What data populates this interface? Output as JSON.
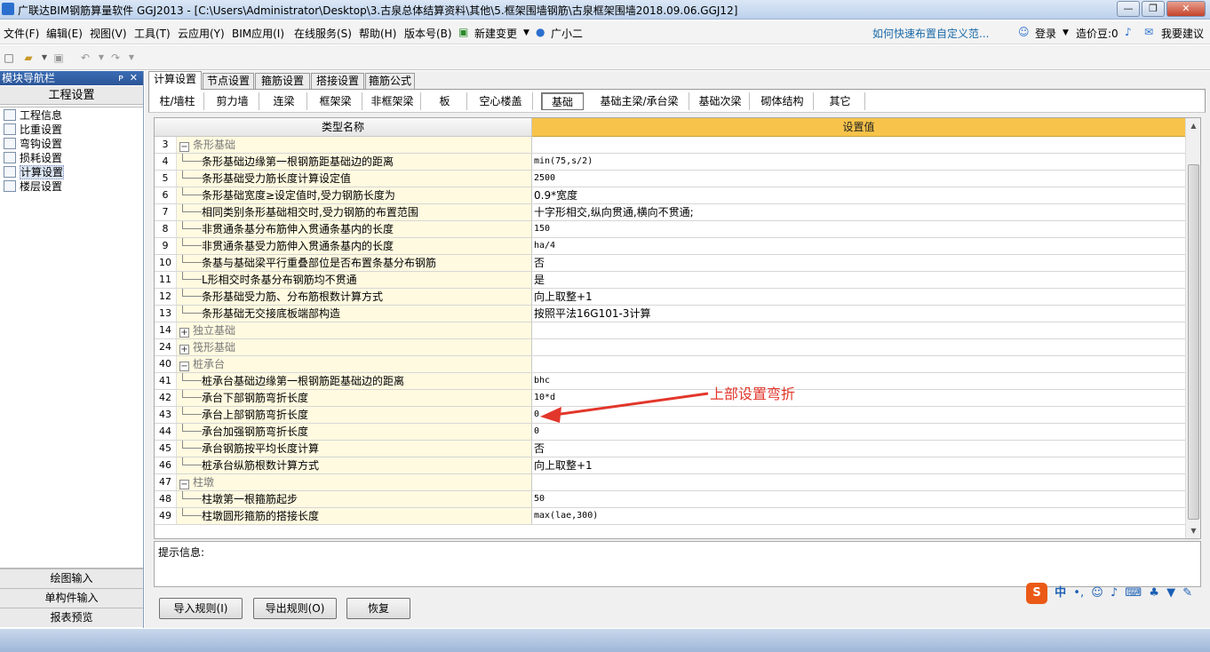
{
  "window": {
    "title": "广联达BIM钢筋算量软件 GGJ2013 - [C:\\Users\\Administrator\\Desktop\\3.古泉总体结算资料\\其他\\5.框架围墙钢筋\\古泉框架围墙2018.09.06.GGJ12]",
    "min": "—",
    "max": "❐",
    "close": "✕"
  },
  "menu": {
    "items": [
      "文件(F)",
      "编辑(E)",
      "视图(V)",
      "工具(T)",
      "云应用(Y)",
      "BIM应用(I)",
      "在线服务(S)",
      "帮助(H)",
      "版本号(B)",
      "新建变更",
      "广小二"
    ],
    "link": "如何快速布置自定义范...",
    "login": "登录",
    "price_bean": "造价豆:0",
    "suggest": "我要建议"
  },
  "nav": {
    "header": "模块导航栏",
    "pin": "ᴘ",
    "close": "✕",
    "section": "工程设置",
    "tree": [
      "工程信息",
      "比重设置",
      "弯钩设置",
      "损耗设置",
      "计算设置",
      "楼层设置"
    ],
    "bottom": [
      "绘图输入",
      "单构件输入",
      "报表预览"
    ]
  },
  "tabs1": [
    "计算设置",
    "节点设置",
    "箍筋设置",
    "搭接设置",
    "箍筋公式"
  ],
  "tabs2": [
    "柱/墙柱",
    "剪力墙",
    "连梁",
    "框架梁",
    "非框架梁",
    "板",
    "空心楼盖",
    "基础",
    "基础主梁/承台梁",
    "基础次梁",
    "砌体结构",
    "其它"
  ],
  "grid": {
    "col_name": "类型名称",
    "col_value": "设置值",
    "rows": [
      {
        "num": "3",
        "name": "条形基础",
        "value": "",
        "group": true,
        "exp": "−"
      },
      {
        "num": "4",
        "name": "条形基础边缘第一根钢筋距基础边的距离",
        "value": "min(75,s/2)"
      },
      {
        "num": "5",
        "name": "条形基础受力筋长度计算设定值",
        "value": "2500"
      },
      {
        "num": "6",
        "name": "条形基础宽度≥设定值时,受力钢筋长度为",
        "value": "0.9*宽度"
      },
      {
        "num": "7",
        "name": "相同类别条形基础相交时,受力钢筋的布置范围",
        "value": "十字形相交,纵向贯通,横向不贯通;"
      },
      {
        "num": "8",
        "name": "非贯通条基分布筋伸入贯通条基内的长度",
        "value": "150"
      },
      {
        "num": "9",
        "name": "非贯通条基受力筋伸入贯通条基内的长度",
        "value": "ha/4"
      },
      {
        "num": "10",
        "name": "条基与基础梁平行重叠部位是否布置条基分布钢筋",
        "value": "否"
      },
      {
        "num": "11",
        "name": "L形相交时条基分布钢筋均不贯通",
        "value": "是"
      },
      {
        "num": "12",
        "name": "条形基础受力筋、分布筋根数计算方式",
        "value": "向上取整+1"
      },
      {
        "num": "13",
        "name": "条形基础无交接底板端部构造",
        "value": "按照平法16G101-3计算"
      },
      {
        "num": "14",
        "name": "独立基础",
        "value": "",
        "group": true,
        "exp": "+"
      },
      {
        "num": "24",
        "name": "筏形基础",
        "value": "",
        "group": true,
        "exp": "+"
      },
      {
        "num": "40",
        "name": "桩承台",
        "value": "",
        "group": true,
        "exp": "−"
      },
      {
        "num": "41",
        "name": "桩承台基础边缘第一根钢筋距基础边的距离",
        "value": "bhc"
      },
      {
        "num": "42",
        "name": "承台下部钢筋弯折长度",
        "value": "10*d"
      },
      {
        "num": "43",
        "name": "承台上部钢筋弯折长度",
        "value": "0"
      },
      {
        "num": "44",
        "name": "承台加强钢筋弯折长度",
        "value": "0"
      },
      {
        "num": "45",
        "name": "承台钢筋按平均长度计算",
        "value": "否"
      },
      {
        "num": "46",
        "name": "桩承台纵筋根数计算方式",
        "value": "向上取整+1"
      },
      {
        "num": "47",
        "name": "柱墩",
        "value": "",
        "group": true,
        "exp": "−"
      },
      {
        "num": "48",
        "name": "柱墩第一根箍筋起步",
        "value": "50"
      },
      {
        "num": "49",
        "name": "柱墩圆形箍筋的搭接长度",
        "value": "max(lae,300)"
      }
    ]
  },
  "hint_label": "提示信息:",
  "buttons": {
    "import": "导入规则(I)",
    "export": "导出规则(O)",
    "restore": "恢复"
  },
  "annotation": "上部设置弯折",
  "ime": {
    "logo": "S",
    "mode": "中",
    "punct": "•,"
  }
}
